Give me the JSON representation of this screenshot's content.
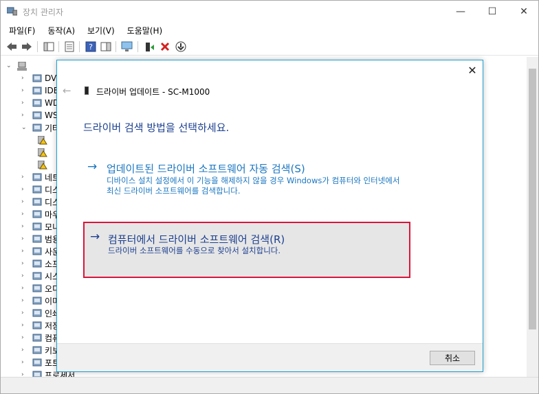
{
  "window": {
    "title": "장치 관리자",
    "min_glyph": "—",
    "max_glyph": "☐",
    "close_glyph": "✕"
  },
  "menu": [
    "파일(F)",
    "동작(A)",
    "보기(V)",
    "도움말(H)"
  ],
  "tree": {
    "items": [
      {
        "label": "DV",
        "icon": "dvd-drive-icon",
        "expanded": false
      },
      {
        "label": "IDE",
        "icon": "ide-controller-icon",
        "expanded": false
      },
      {
        "label": "WD",
        "icon": "wd-drive-icon",
        "expanded": false
      },
      {
        "label": "WS",
        "icon": "wsd-print-icon",
        "expanded": false
      },
      {
        "label": "기타",
        "icon": "other-devices-icon",
        "expanded": true
      },
      {
        "label": "",
        "icon": "warning-device-icon",
        "child": true
      },
      {
        "label": "",
        "icon": "warning-device-icon",
        "child": true
      },
      {
        "label": "",
        "icon": "warning-device-icon",
        "child": true
      },
      {
        "label": "네트",
        "icon": "network-icon",
        "expanded": false
      },
      {
        "label": "디스",
        "icon": "disk-drive-icon",
        "expanded": false
      },
      {
        "label": "디스",
        "icon": "display-adapter-icon",
        "expanded": false
      },
      {
        "label": "마우",
        "icon": "mouse-icon",
        "expanded": false
      },
      {
        "label": "모니",
        "icon": "monitor-icon",
        "expanded": false
      },
      {
        "label": "범용",
        "icon": "usb-controller-icon",
        "expanded": false
      },
      {
        "label": "사운",
        "icon": "sound-icon",
        "expanded": false
      },
      {
        "label": "소프",
        "icon": "software-device-icon",
        "expanded": false
      },
      {
        "label": "시스",
        "icon": "system-device-icon",
        "expanded": false
      },
      {
        "label": "오디",
        "icon": "audio-io-icon",
        "expanded": false
      },
      {
        "label": "이미",
        "icon": "imaging-device-icon",
        "expanded": false
      },
      {
        "label": "인쇄",
        "icon": "print-queue-icon",
        "expanded": false
      },
      {
        "label": "저장",
        "icon": "storage-controller-icon",
        "expanded": false
      },
      {
        "label": "컴퓨",
        "icon": "computer-icon",
        "expanded": false
      },
      {
        "label": "키보",
        "icon": "keyboard-icon",
        "expanded": false
      },
      {
        "label": "포트",
        "icon": "ports-icon",
        "expanded": false
      },
      {
        "label": "프로세서",
        "icon": "processor-icon",
        "expanded": false
      }
    ]
  },
  "dialog": {
    "close_glyph": "✕",
    "back_glyph": "←",
    "title": "드라이버 업데이트 - SC-M1000",
    "heading": "드라이버 검색 방법을 선택하세요.",
    "option_auto": {
      "arrow": "→",
      "label": "업데이트된 드라이버 소프트웨어 자동 검색(S)",
      "desc": "디바이스 설치 설정에서 이 기능을 해제하지 않을 경우 Windows가 컴퓨터와 인터넷에서 최신 드라이버 소프트웨어를 검색합니다."
    },
    "option_manual": {
      "arrow": "→",
      "label": "컴퓨터에서 드라이버 소프트웨어 검색(R)",
      "desc": "드라이버 소프트웨어를 수동으로 찾아서 설치합니다."
    },
    "cancel_label": "취소"
  },
  "colors": {
    "accent_blue": "#1a76c1",
    "heading_navy": "#1c3f8f",
    "highlight_red": "#d9153a",
    "dialog_border": "#1ea0d0"
  }
}
